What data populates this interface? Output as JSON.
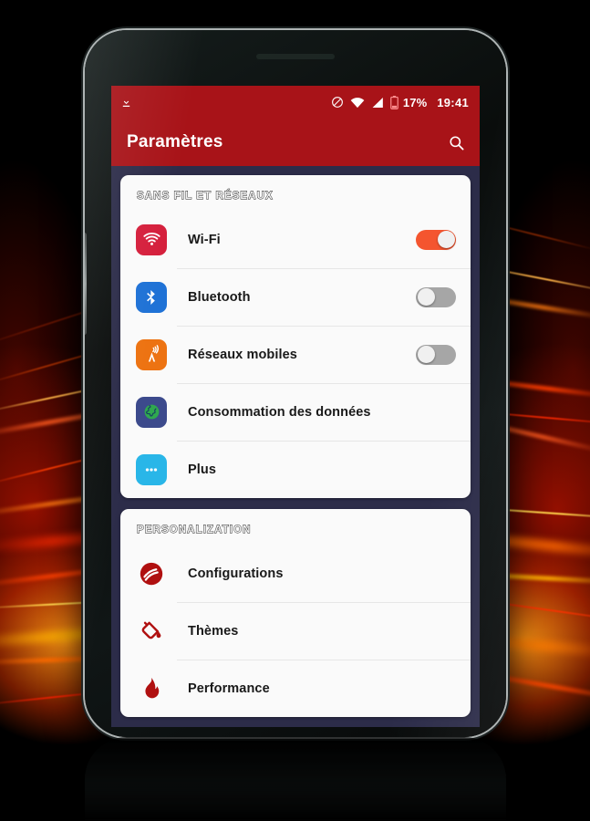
{
  "background": {
    "style": "abstract-red-orange-light-streaks-on-black",
    "colors": {
      "black": "#000000",
      "orange": "#ff9614",
      "red": "#be1400",
      "yellow": "#ffd24a"
    }
  },
  "device": {
    "label": "android-smartphone-mockup",
    "bezel_color": "#0d1211",
    "edge_color": "#d7dede",
    "has_reflection": true
  },
  "screen": {
    "background_color": "#2c2c49",
    "accent_color": "#a81318"
  },
  "statusbar": {
    "download_icon": "download-icon",
    "icons": [
      "do-not-disturb-icon",
      "wifi-icon",
      "cellular-signal-icon",
      "battery-icon"
    ],
    "battery_percent": "17%",
    "clock": "19:41"
  },
  "appbar": {
    "title": "Paramètres",
    "search_icon": "search-icon"
  },
  "sections": [
    {
      "title": "SANS FIL ET RÉSEAUX",
      "rows": [
        {
          "label": "Wi-Fi",
          "icon": "wifi-icon",
          "icon_bg": "#d51f3c",
          "toggle": "on"
        },
        {
          "label": "Bluetooth",
          "icon": "bluetooth-icon",
          "icon_bg": "#1f72d6",
          "toggle": "off"
        },
        {
          "label": "Réseaux mobiles",
          "icon": "cell-tower-icon",
          "icon_bg": "#ed7312",
          "toggle": "off"
        },
        {
          "label": "Consommation des données",
          "icon": "globe-icon",
          "icon_bg": "#3c4a8c",
          "toggle": "none"
        },
        {
          "label": "Plus",
          "icon": "more-dots-icon",
          "icon_bg": "#29b6e8",
          "toggle": "none"
        }
      ]
    },
    {
      "title": "PERSONALIZATION",
      "rows": [
        {
          "label": "Configurations",
          "icon": "config-circle-icon",
          "icon_color": "#b01010",
          "toggle": "none"
        },
        {
          "label": "Thèmes",
          "icon": "paint-bucket-icon",
          "icon_color": "#b01010",
          "toggle": "none"
        },
        {
          "label": "Performance",
          "icon": "flame-icon",
          "icon_color": "#b01010",
          "toggle": "none"
        }
      ]
    }
  ]
}
